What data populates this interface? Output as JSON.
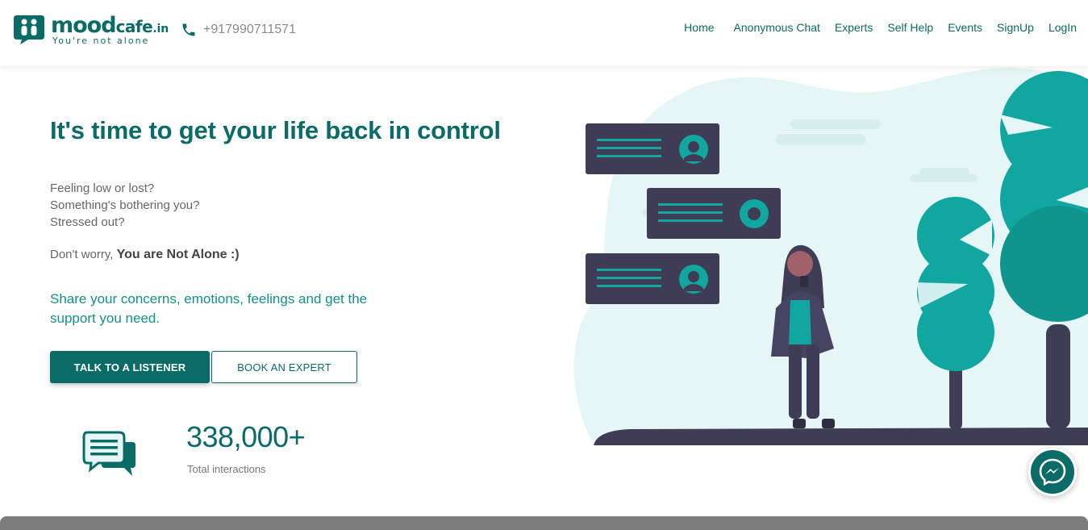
{
  "brand": {
    "name_main": "mood",
    "name_sub": "cafe",
    "name_tld": ".in",
    "tagline": "You're not alone",
    "logo_icon": "people-chat-icon"
  },
  "contact": {
    "phone": "+917990711571",
    "icon": "phone-icon"
  },
  "nav": {
    "items": [
      {
        "label": "Home"
      },
      {
        "label": "Anonymous Chat"
      },
      {
        "label": "Experts"
      },
      {
        "label": "Self Help"
      },
      {
        "label": "Events"
      },
      {
        "label": "SignUp"
      },
      {
        "label": "LogIn"
      }
    ]
  },
  "hero": {
    "title": "It's time to get your life back in control",
    "questions": [
      "Feeling low or lost?",
      "Something's bothering you?",
      "Stressed out?"
    ],
    "worry_prefix": "Don't worry,",
    "worry_emphasis": "You are Not Alone :)",
    "share_text": "Share your concerns, emotions, feelings and get the support you need.",
    "primary_button": "TALK TO A LISTENER",
    "secondary_button": "BOOK AN EXPERT"
  },
  "stats": {
    "value": "338,000+",
    "label": "Total interactions",
    "icon": "chat-bubbles-icon"
  },
  "messenger": {
    "icon": "messenger-icon"
  },
  "colors": {
    "brand": "#0b6b66",
    "accent": "#12a6a0",
    "dark": "#3f3d56",
    "bg_blob": "#e6f6f6"
  }
}
